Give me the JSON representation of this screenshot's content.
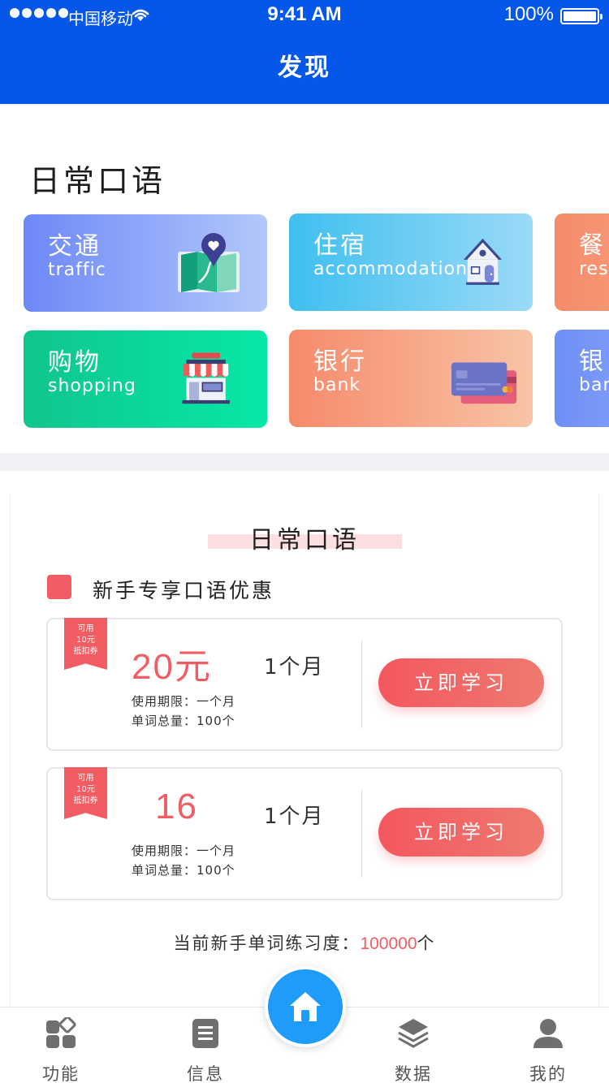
{
  "status_bar": {
    "carrier": "中国移动",
    "time": "9:41 AM",
    "battery": "100%"
  },
  "header": {
    "title": "发现"
  },
  "daily": {
    "title": "日常口语",
    "cards": [
      {
        "cn": "交通",
        "en": "traffic",
        "icon": "map-pin-icon"
      },
      {
        "cn": "住宿",
        "en": "accommodation",
        "icon": "house-icon"
      },
      {
        "cn": "餐",
        "en": "res",
        "icon": "restaurant-icon"
      },
      {
        "cn": "购物",
        "en": "shopping",
        "icon": "shop-icon"
      },
      {
        "cn": "银行",
        "en": "bank",
        "icon": "credit-card-icon"
      },
      {
        "cn": "银",
        "en": "ban",
        "icon": "bank-icon"
      }
    ]
  },
  "promo": {
    "title": "日常口语",
    "subtitle": "新手专享口语优惠",
    "ribbon": [
      "可用",
      "10元",
      "抵扣券"
    ],
    "offers": [
      {
        "price": "20元",
        "period": "1个月",
        "meta1": "使用期限：一个月",
        "meta2": "单词总量：100个",
        "button": "立即学习"
      },
      {
        "price": "16",
        "period": "1个月",
        "meta1": "使用期限：一个月",
        "meta2": "单词总量：100个",
        "button": "立即学习"
      }
    ],
    "progress_label": "当前新手单词练习度：",
    "progress_value": "100000",
    "progress_unit": "个"
  },
  "tabbar": {
    "tabs": [
      {
        "label": "功能",
        "icon": "grid-icon"
      },
      {
        "label": "信息",
        "icon": "document-icon"
      },
      {
        "label": "数据",
        "icon": "layers-icon"
      },
      {
        "label": "我的",
        "icon": "user-icon"
      }
    ],
    "center_icon": "home-icon"
  },
  "colors": {
    "brand_blue": "#0457e8",
    "accent_red": "#f25d63",
    "home_blue": "#1e9bfb"
  }
}
